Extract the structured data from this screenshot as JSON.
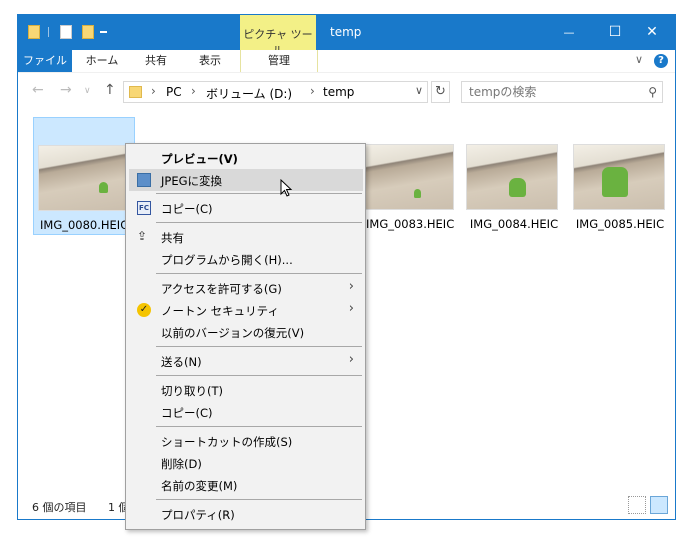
{
  "titlebar": {
    "title": "temp",
    "contextual_tab": "ピクチャ ツール",
    "controls": {
      "minimize": "—",
      "maximize": "☐",
      "close": "✕"
    }
  },
  "ribbon": {
    "file_tab": "ファイル",
    "tabs": [
      "ホーム",
      "共有",
      "表示",
      "管理"
    ]
  },
  "address": {
    "segments": [
      "PC",
      "ボリューム (D:)",
      "temp"
    ],
    "search_placeholder": "tempの検索"
  },
  "files": [
    {
      "name": "IMG_0080.HEIC",
      "selected": true
    },
    {
      "name": "IMG_0083.HEIC",
      "selected": false
    },
    {
      "name": "IMG_0084.HEIC",
      "selected": false
    },
    {
      "name": "IMG_0085.HEIC",
      "selected": false
    }
  ],
  "status": {
    "item_count": "6 個の項目",
    "selected_count": "1 個"
  },
  "context_menu": {
    "items": [
      {
        "label": "プレビュー(V)",
        "bold": true
      },
      {
        "label": "JPEGに変換",
        "icon": "convert-app-icon",
        "hover": true
      },
      {
        "label": "コピー(C)",
        "icon": "fastcopy-icon"
      },
      {
        "label": "共有",
        "icon": "share-icon"
      },
      {
        "label": "プログラムから開く(H)..."
      },
      {
        "label": "アクセスを許可する(G)",
        "submenu": true
      },
      {
        "label": "ノートン セキュリティ",
        "icon": "norton-check-icon",
        "submenu": true
      },
      {
        "label": "以前のバージョンの復元(V)"
      },
      {
        "label": "送る(N)",
        "submenu": true
      },
      {
        "label": "切り取り(T)"
      },
      {
        "label": "コピー(C)"
      },
      {
        "label": "ショートカットの作成(S)"
      },
      {
        "label": "削除(D)"
      },
      {
        "label": "名前の変更(M)"
      },
      {
        "label": "プロパティ(R)"
      }
    ]
  },
  "colors": {
    "accent": "#1979ca",
    "context_tab": "#f3f087",
    "selection": "#cce8ff"
  }
}
